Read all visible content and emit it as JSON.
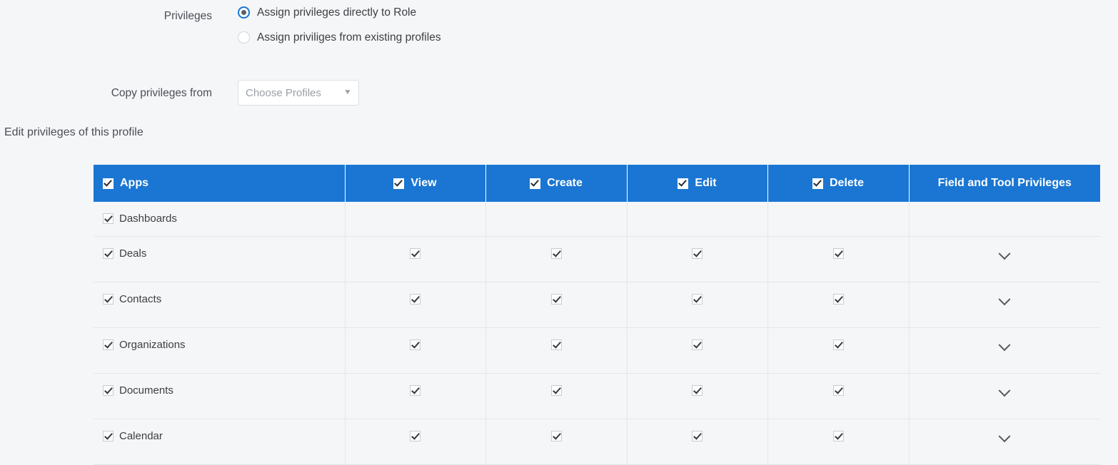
{
  "form": {
    "privileges_label": "Privileges",
    "radio_options": [
      {
        "label": "Assign privileges directly to Role",
        "selected": true
      },
      {
        "label": "Assign priviliges from existing profiles",
        "selected": false
      }
    ],
    "copy_label": "Copy privileges from",
    "profiles_select": {
      "value": "Choose Profiles",
      "placeholder": "Choose Profiles",
      "caret_icon": "chevron-down-icon"
    }
  },
  "section_title": "Edit privileges of this profile",
  "table": {
    "accent_color": "#1a76d2",
    "header_text_color": "#ffffff",
    "row_background": "#f5f6f8",
    "border_color": "#e3e6ea",
    "columns": [
      {
        "label": "Apps",
        "checkbox": true,
        "checked": true,
        "align": "left"
      },
      {
        "label": "View",
        "checkbox": true,
        "checked": true,
        "align": "center"
      },
      {
        "label": "Create",
        "checkbox": true,
        "checked": true,
        "align": "center"
      },
      {
        "label": "Edit",
        "checkbox": true,
        "checked": true,
        "align": "center"
      },
      {
        "label": "Delete",
        "checkbox": true,
        "checked": true,
        "align": "center"
      },
      {
        "label": "Field and Tool Privileges",
        "checkbox": false,
        "checked": false,
        "align": "center"
      }
    ],
    "rows": [
      {
        "app": "Dashboards",
        "app_checked": true,
        "view": null,
        "create": null,
        "edit": null,
        "delete": null,
        "expand": false
      },
      {
        "app": "Deals",
        "app_checked": true,
        "view": true,
        "create": true,
        "edit": true,
        "delete": true,
        "expand": true
      },
      {
        "app": "Contacts",
        "app_checked": true,
        "view": true,
        "create": true,
        "edit": true,
        "delete": true,
        "expand": true
      },
      {
        "app": "Organizations",
        "app_checked": true,
        "view": true,
        "create": true,
        "edit": true,
        "delete": true,
        "expand": true
      },
      {
        "app": "Documents",
        "app_checked": true,
        "view": true,
        "create": true,
        "edit": true,
        "delete": true,
        "expand": true
      },
      {
        "app": "Calendar",
        "app_checked": true,
        "view": true,
        "create": true,
        "edit": true,
        "delete": true,
        "expand": true
      }
    ],
    "expand_icon": "chevron-down-icon"
  }
}
